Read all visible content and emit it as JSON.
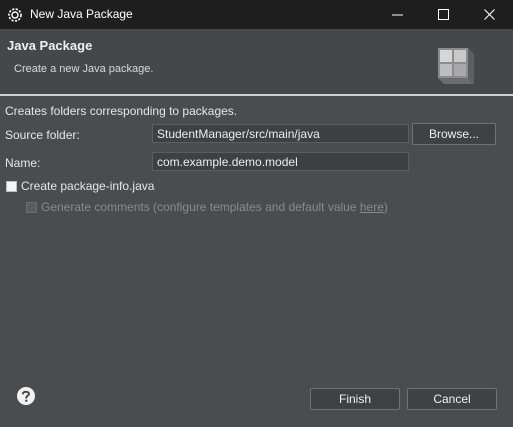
{
  "window": {
    "title": "New Java Package",
    "app_icon": "gear-icon",
    "controls": [
      "minimize-icon",
      "maximize-icon",
      "close-icon"
    ]
  },
  "header": {
    "title": "Java Package",
    "subtitle": "Create a new Java package.",
    "icon": "package-wizard-icon"
  },
  "form": {
    "description": "Creates folders corresponding to packages.",
    "source_folder_label": "Source folder:",
    "source_folder_value": "StudentManager/src/main/java",
    "browse_label": "Browse...",
    "name_label": "Name:",
    "name_value": "com.example.demo.model",
    "create_info_label": "Create package-info.java",
    "create_info_checked": false,
    "generate_comments_label": "Generate comments (configure templates and default value ",
    "generate_comments_link": "here",
    "generate_comments_suffix": ")",
    "generate_comments_checked": false,
    "generate_comments_enabled": false
  },
  "footer": {
    "help_icon": "help-icon",
    "finish_label": "Finish",
    "cancel_label": "Cancel"
  },
  "colors": {
    "titlebar": "#1e1e1e",
    "background": "#4a4d50",
    "header": "#45484b",
    "separator": "#cfcfcf"
  }
}
